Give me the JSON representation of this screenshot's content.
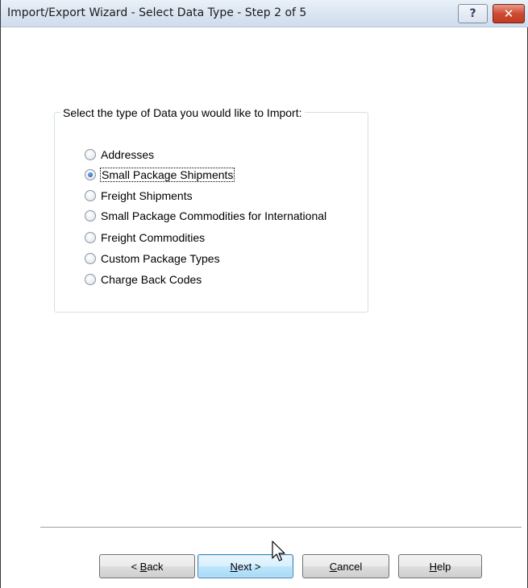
{
  "window": {
    "title": "Import/Export Wizard - Select Data Type - Step 2 of 5",
    "help_glyph": "?",
    "close_glyph": "✕"
  },
  "group": {
    "legend": "Select the type of Data you would like to Import:",
    "options": [
      {
        "label": "Addresses",
        "checked": false
      },
      {
        "label": "Small Package Shipments",
        "checked": true
      },
      {
        "label": "Freight Shipments",
        "checked": false
      },
      {
        "label": "Small Package Commodities for International",
        "checked": false
      },
      {
        "label": "Freight Commodities",
        "checked": false
      },
      {
        "label": "Custom Package Types",
        "checked": false
      },
      {
        "label": "Charge Back Codes",
        "checked": false
      }
    ]
  },
  "buttons": {
    "back": {
      "prefix": "< ",
      "mnemonic": "B",
      "rest": "ack"
    },
    "next": {
      "mnemonic": "N",
      "rest": "ext >"
    },
    "cancel": {
      "mnemonic": "C",
      "rest": "ancel"
    },
    "help": {
      "mnemonic": "H",
      "rest": "elp"
    }
  },
  "icons": {
    "help": "help-icon",
    "close": "close-icon",
    "cursor": "mouse-pointer-icon"
  },
  "colors": {
    "close_button": "#c23a23",
    "default_button_border": "#3c7fb1",
    "radio_dot": "#1a4f9c"
  }
}
